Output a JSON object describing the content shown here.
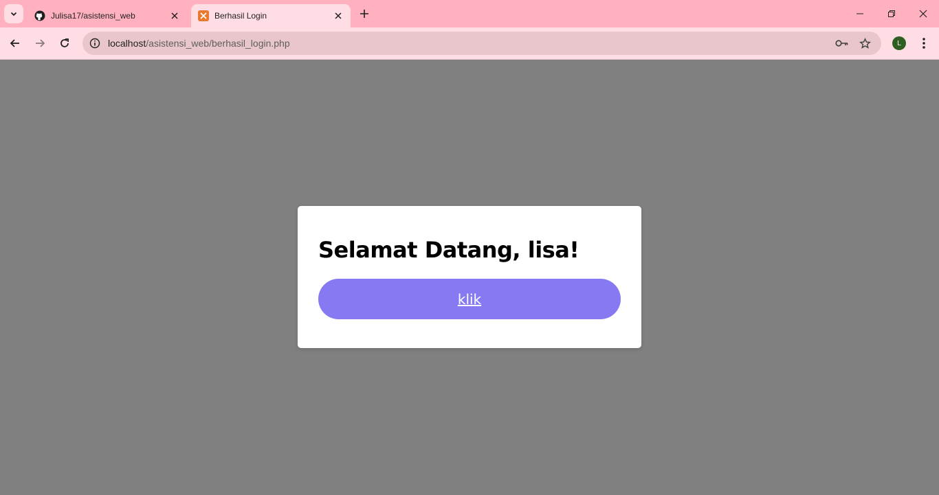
{
  "browser": {
    "tabs": [
      {
        "title": "Julisa17/asistensi_web",
        "icon": "github-icon",
        "active": false
      },
      {
        "title": "Berhasil Login",
        "icon": "xampp-icon",
        "active": true
      }
    ],
    "address": {
      "host": "localhost",
      "path": "/asistensi_web/berhasil_login.php"
    },
    "profile_initial": "L",
    "colors": {
      "tabstrip": "#ffb1c0",
      "toolbar": "#ffdde4",
      "omnibox": "#e8c6cc",
      "avatar": "#2e5e21"
    }
  },
  "page": {
    "heading": "Selamat Datang, lisa!",
    "button_label": "klik",
    "colors": {
      "background": "#808080",
      "card": "#ffffff",
      "button": "#8679f1"
    }
  }
}
